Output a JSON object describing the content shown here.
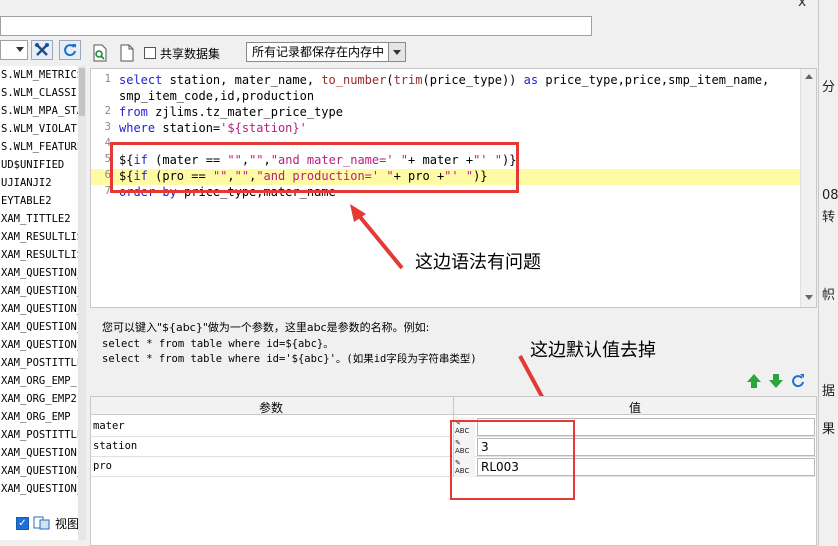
{
  "window": {
    "close_label": "x"
  },
  "right_strip": {
    "chars": [
      "分",
      "08",
      "转",
      "帜",
      "据",
      "果"
    ]
  },
  "left": {
    "items": [
      "S.WLM_METRICS",
      "S.WLM_CLASSIF",
      "S.WLM_MPA_STA",
      "S.WLM_VIOLATI",
      "S.WLM_FEATURE",
      "UD$UNIFIED",
      "UJIANJI2",
      "EYTABLE2",
      "XAM_TITTLE2",
      "XAM_RESULTLIS",
      "XAM_RESULTLIS",
      "XAM_QUESTION_",
      "XAM_QUESTION_",
      "XAM_QUESTION_",
      "XAM_QUESTION_",
      "XAM_QUESTION_",
      "XAM_POSTITTLE",
      "XAM_ORG_EMP_",
      "XAM_ORG_EMP2",
      "XAM_ORG_EMP",
      "XAM_POSTITTLE",
      "XAM_QUESTION",
      "XAM_QUESTION_",
      "XAM_QUESTION_"
    ],
    "view_label": "视图"
  },
  "toolbar": {
    "share_label": "共享数据集",
    "mode_select": "所有记录都保存在内存中"
  },
  "editor": {
    "lines": [
      {
        "n": "1",
        "t": "select station, mater_name, to_number(trim(price_type)) as price_type,price,smp_item_name,"
      },
      {
        "n": "",
        "t": "smp_item_code,id,production"
      },
      {
        "n": "2",
        "t": "from zjlims.tz_mater_price_type"
      },
      {
        "n": "3",
        "t": "where station='${station}'"
      },
      {
        "n": "4",
        "t": ""
      },
      {
        "n": "5",
        "t": "${if (mater == \"\",\"\",\"and mater_name=' \"+ mater +\"' \")}"
      },
      {
        "n": "6",
        "t": "${if (pro == \"\",\"\",\"and production=' \"+ pro +\"' \")}"
      },
      {
        "n": "7",
        "t": "order by price_type,mater_name"
      }
    ]
  },
  "annotations": {
    "note_syntax": "这边语法有问题",
    "note_default": "这边默认值去掉"
  },
  "hint": {
    "line1": "您可以键入\"${abc}\"做为一个参数，这里abc是参数的名称。例如:",
    "line2": "select * from table where id=${abc}。",
    "line3": "select * from table where id='${abc}'。(如果id字段为字符串类型)"
  },
  "params": {
    "col_name": "参数",
    "col_value": "值",
    "icon_text": "ABC",
    "rows": [
      {
        "name": "mater",
        "value": ""
      },
      {
        "name": "station",
        "value": "3"
      },
      {
        "name": "pro",
        "value": "RL003"
      }
    ]
  }
}
